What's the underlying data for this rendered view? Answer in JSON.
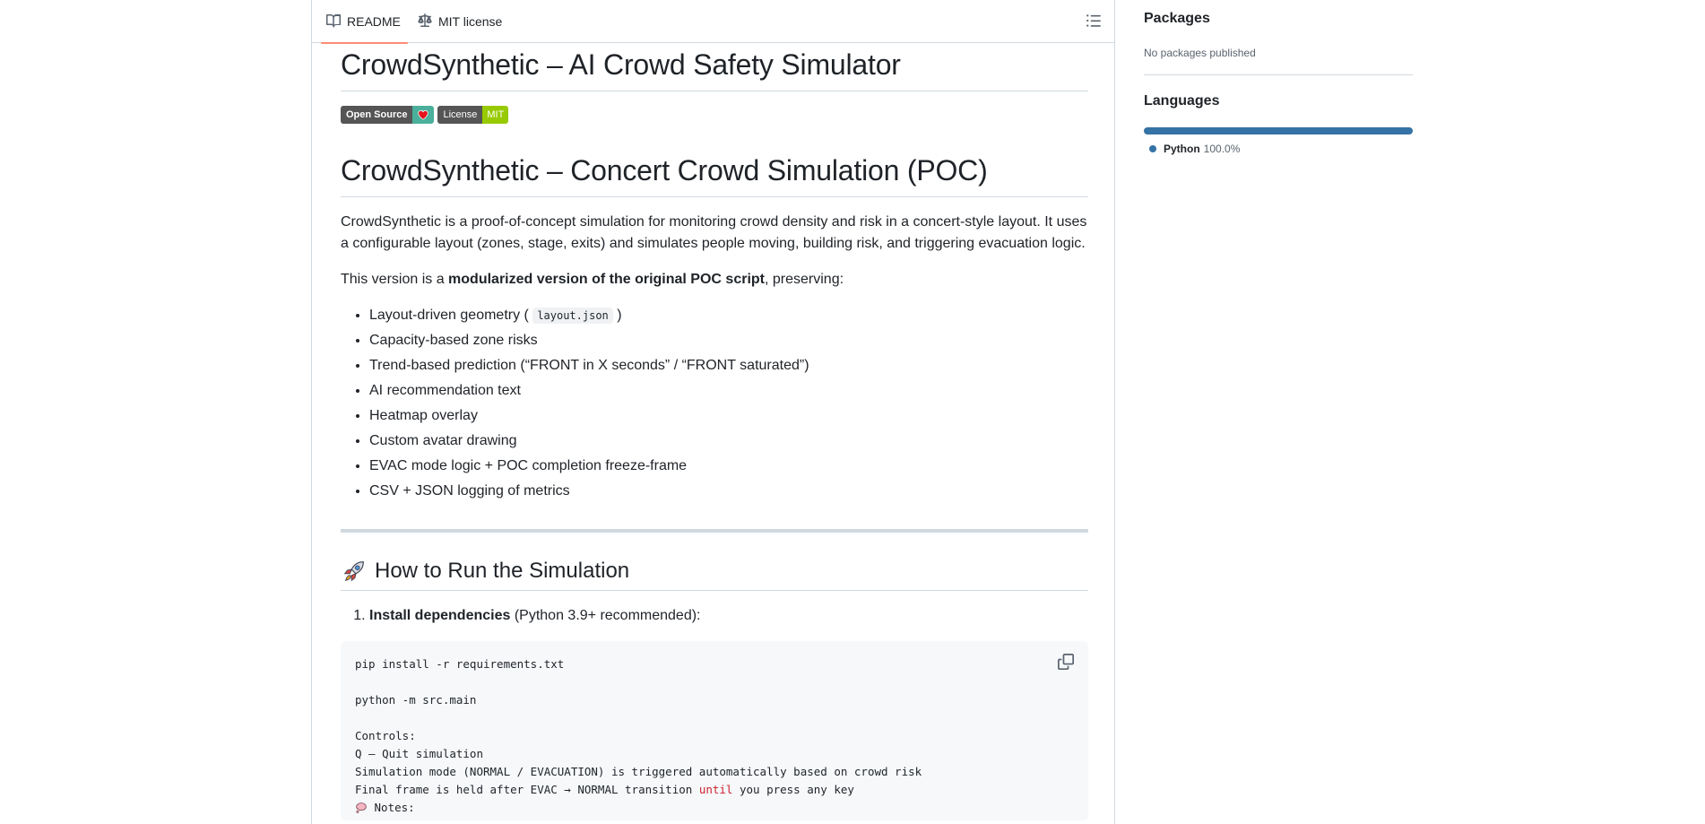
{
  "tabs": {
    "readme": "README",
    "license": "MIT license"
  },
  "readme": {
    "title": "CrowdSynthetic – AI Crowd Safety Simulator",
    "badges": [
      {
        "label": "Open Source",
        "value_icon": "heart-icon"
      },
      {
        "label": "License",
        "value": "MIT"
      }
    ],
    "subtitle": "CrowdSynthetic – Concert Crowd Simulation (POC)",
    "intro": "CrowdSynthetic is a proof-of-concept simulation for monitoring crowd density and risk in a concert-style layout. It uses a configurable layout (zones, stage, exits) and simulates people moving, building risk, and triggering evacuation logic.",
    "version_prefix": "This version is a ",
    "version_bold": "modularized version of the original POC script",
    "version_suffix": ", preserving:",
    "features": [
      {
        "text_before": "Layout-driven geometry ( ",
        "code": "layout.json",
        "text_after": " )"
      },
      {
        "text_before": "Capacity-based zone risks"
      },
      {
        "text_before": "Trend-based prediction (“FRONT in X seconds” / “FRONT saturated”)"
      },
      {
        "text_before": "AI recommendation text"
      },
      {
        "text_before": "Heatmap overlay"
      },
      {
        "text_before": "Custom avatar drawing"
      },
      {
        "text_before": "EVAC mode logic + POC completion freeze-frame"
      },
      {
        "text_before": "CSV + JSON logging of metrics"
      }
    ],
    "run_heading": "How to Run the Simulation",
    "step1_bold": "Install dependencies",
    "step1_rest": " (Python 3.9+ recommended):",
    "code_lines": [
      "pip install -r requirements.txt",
      "",
      "python -m src.main",
      "",
      "Controls:",
      "Q – Quit simulation",
      "Simulation mode (NORMAL / EVACUATION) is triggered automatically based on crowd risk"
    ],
    "code_line_final_a": "Final frame is held after EVAC → NORMAL transition ",
    "code_line_final_kw": "until",
    "code_line_final_b": " you press any key",
    "code_notes": " Notes:"
  },
  "sidebar": {
    "packages_title": "Packages",
    "packages_empty": "No packages published",
    "languages_title": "Languages",
    "languages": [
      {
        "name": "Python",
        "percent": "100.0%",
        "share": 100,
        "color": "#3572a5"
      }
    ]
  },
  "colors": {
    "tab_underline": "#fd8c73",
    "badge_heart": "#4bb09b",
    "badge_mit": "#97ca00",
    "python": "#3572a5"
  }
}
